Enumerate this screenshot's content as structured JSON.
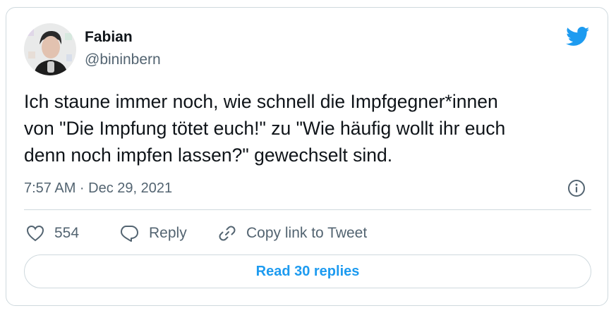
{
  "author": {
    "name": "Fabian",
    "handle": "@bininbern"
  },
  "tweet": {
    "text": "Ich staune immer noch, wie schnell die Impfgegner*innen\nvon \"Die Impfung tötet euch!\" zu \"Wie häufig wollt ihr euch\ndenn noch impfen lassen?\" gewechselt sind.",
    "timestamp": "7:57 AM · Dec 29, 2021"
  },
  "actions": {
    "like_count": "554",
    "reply_label": "Reply",
    "copy_label": "Copy link to Tweet"
  },
  "footer": {
    "read_replies_label": "Read 30 replies"
  },
  "colors": {
    "brand": "#1d9bf0",
    "text": "#0f1419",
    "muted": "#536471",
    "border": "#cfd9de"
  },
  "icons": [
    "twitter-bird-icon",
    "info-icon",
    "heart-icon",
    "reply-icon",
    "link-icon"
  ]
}
